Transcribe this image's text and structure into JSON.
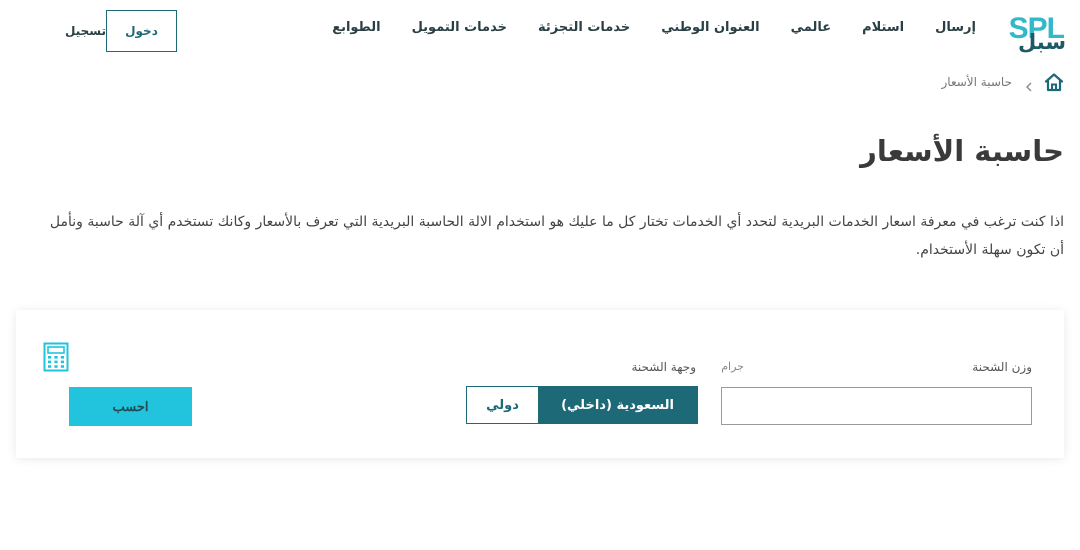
{
  "header": {
    "logo": {
      "latin": "SPL",
      "arabic": "سبل",
      "color": "#32b8c9"
    },
    "nav": [
      {
        "label": "إرسال",
        "name": "nav-send"
      },
      {
        "label": "استلام",
        "name": "nav-receive"
      },
      {
        "label": "عالمي",
        "name": "nav-global"
      },
      {
        "label": "العنوان الوطني",
        "name": "nav-national-address"
      },
      {
        "label": "خدمات التجزئة",
        "name": "nav-retail-services"
      },
      {
        "label": "خدمات التمويل",
        "name": "nav-finance-services"
      },
      {
        "label": "الطوابع",
        "name": "nav-stamps"
      }
    ],
    "login_label": "دخول",
    "register_label": "تسجيل"
  },
  "breadcrumb": {
    "home_icon": "home-icon",
    "separator_icon": "chevron-left-icon",
    "current": "حاسبة الأسعار"
  },
  "page": {
    "title": "حاسبة الأسعار",
    "intro": "اذا كنت ترغب في معرفة اسعار الخدمات البريدية لتحدد أي الخدمات تختار كل ما عليك هو استخدام الالة الحاسبة البريدية التي تعرف بالأسعار وكانك تستخدم أي آلة حاسبة ونأمل أن تكون سهلة الأستخدام."
  },
  "calculator": {
    "weight_label": "وزن الشحنة",
    "unit_label": "جرام",
    "weight_value": "",
    "weight_placeholder": "",
    "destination_label": "وجهة الشحنة",
    "destination_options": [
      "السعودية (داخلي)",
      "دولي"
    ],
    "destination_selected": "السعودية (داخلي)",
    "calculate_label": "احسب",
    "icon": "calculator-icon"
  },
  "colors": {
    "primary_dark": "#1e6978",
    "accent": "#22c3dc",
    "logo_dark": "#1e5a66"
  }
}
